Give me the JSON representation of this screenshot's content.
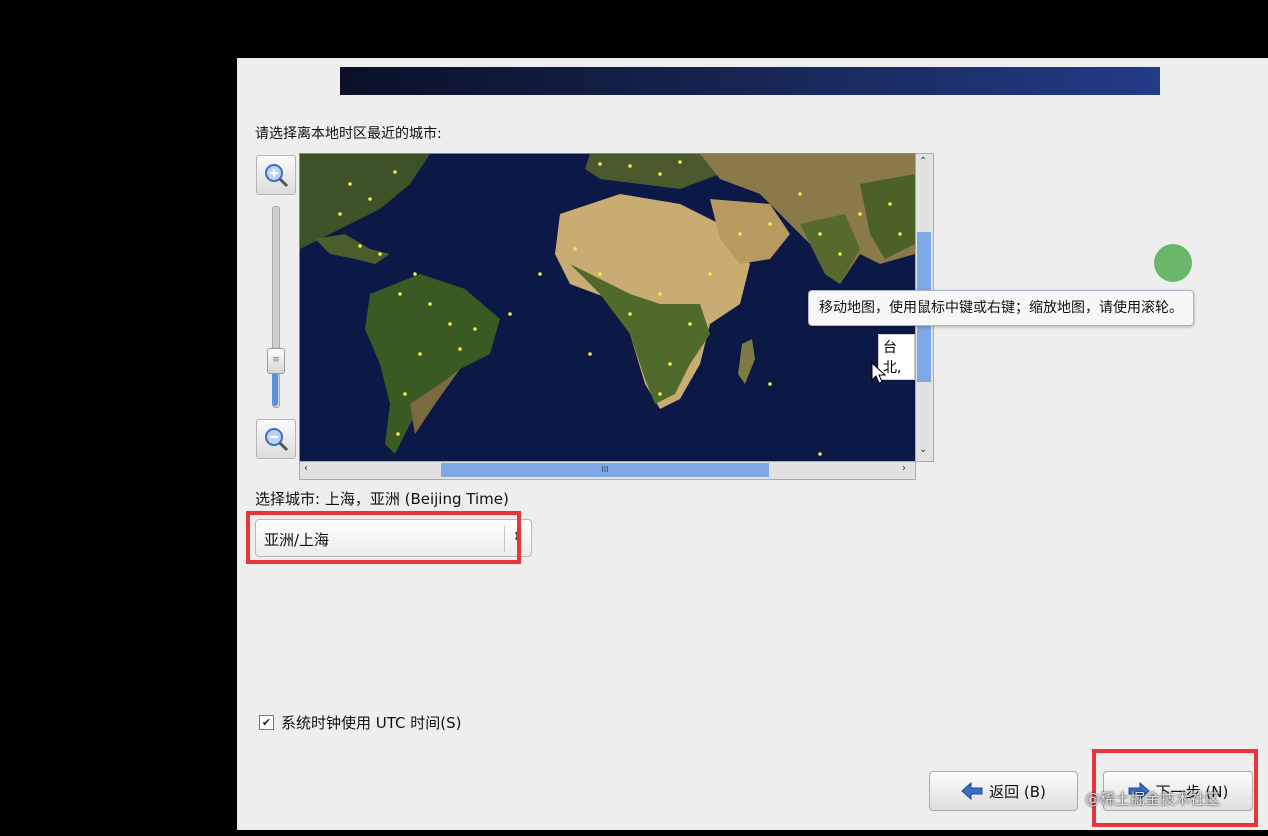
{
  "timezone": {
    "prompt": "请选择离本地时区最近的城市:",
    "map_city_label": "台北,",
    "tooltip": "移动地图，使用鼠标中键或右键；缩放地图，请使用滚轮。",
    "selected_city_label": "选择城市: 上海，亚洲 (Beijing Time)",
    "city_combo_value": "亚洲/上海",
    "utc_label": "系统时钟使用 UTC 时间(S)",
    "utc_checked": true
  },
  "buttons": {
    "back_label": "返回 (B)",
    "next_label": "下一步 (N)"
  },
  "watermark": "@稀土掘金技术社区",
  "icons": [
    "zoom-in-icon",
    "zoom-out-icon",
    "arrow-left-icon",
    "arrow-right-icon",
    "chevron-up-down-icon",
    "mouse-cursor-icon"
  ],
  "colors": {
    "highlight": "#e8343a",
    "ocean": "#0c1846",
    "scroll_thumb": "#7fa9e6"
  },
  "map": {
    "zoom_level_percent": 45
  }
}
